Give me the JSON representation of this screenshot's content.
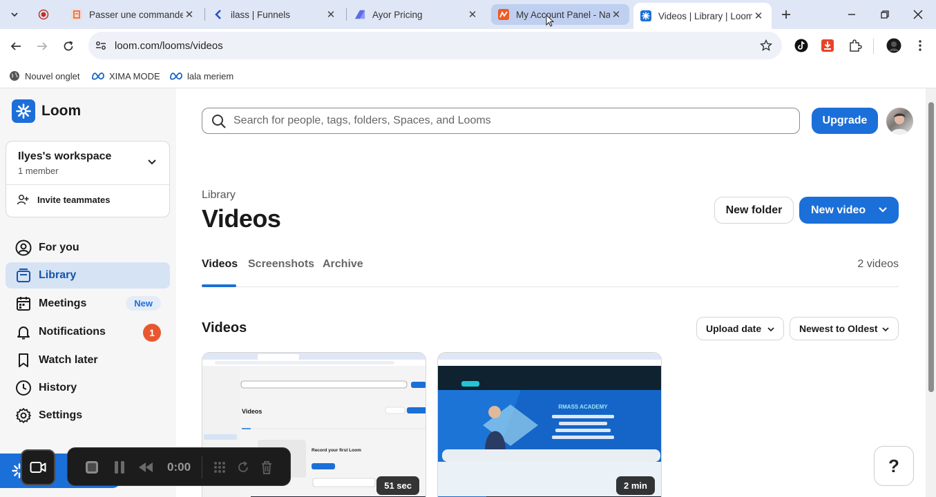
{
  "browser": {
    "tabs": [
      {
        "title": "Passer une commande",
        "favicon": "document-icon",
        "color": "#e05a2a"
      },
      {
        "title": "ilass | Funnels",
        "favicon": "chevron-left-icon",
        "color": "#2750c9"
      },
      {
        "title": "Ayor Pricing",
        "favicon": "ayor-icon",
        "color": "#5a6ce8"
      },
      {
        "title": "My Account Panel - Na",
        "favicon": "panel-icon",
        "color": "#f05a24"
      },
      {
        "title": "Videos | Library | Loom",
        "favicon": "loom-icon",
        "color": "#1d6fd8"
      }
    ],
    "url": "loom.com/looms/videos",
    "bookmarks": [
      {
        "label": "Nouvel onglet",
        "icon": "globe-icon"
      },
      {
        "label": "XIMA MODE",
        "icon": "meta-icon"
      },
      {
        "label": "lala meriem",
        "icon": "meta-icon"
      }
    ]
  },
  "app": {
    "name": "Loom",
    "workspace": {
      "name": "Ilyes's workspace",
      "members": "1 member",
      "invite_label": "Invite teammates"
    },
    "nav": [
      {
        "label": "For you",
        "icon": "user-circle-icon"
      },
      {
        "label": "Library",
        "icon": "library-icon"
      },
      {
        "label": "Meetings",
        "icon": "calendar-icon",
        "badge": "New"
      },
      {
        "label": "Notifications",
        "icon": "bell-icon",
        "count": "1"
      },
      {
        "label": "Watch later",
        "icon": "bookmark-icon"
      },
      {
        "label": "History",
        "icon": "clock-icon"
      },
      {
        "label": "Settings",
        "icon": "gear-icon"
      }
    ],
    "search_placeholder": "Search for people, tags, folders, Spaces, and Looms",
    "upgrade_label": "Upgrade",
    "breadcrumb": "Library",
    "page_title": "Videos",
    "new_folder_label": "New folder",
    "new_video_label": "New video",
    "tabs": [
      "Videos",
      "Screenshots",
      "Archive"
    ],
    "video_count": "2 videos",
    "section_title": "Videos",
    "sort_field": "Upload date",
    "sort_order": "Newest to Oldest",
    "videos": [
      {
        "duration": "51 sec",
        "thumb_page_title": "Videos",
        "thumb_cta": "Record your first Loom"
      },
      {
        "duration": "2 min",
        "thumb_heading": "RMASS ACADEMY"
      }
    ],
    "help_label": "?",
    "recorder": {
      "time": "0:00"
    },
    "accent": "#1b6fd8"
  }
}
